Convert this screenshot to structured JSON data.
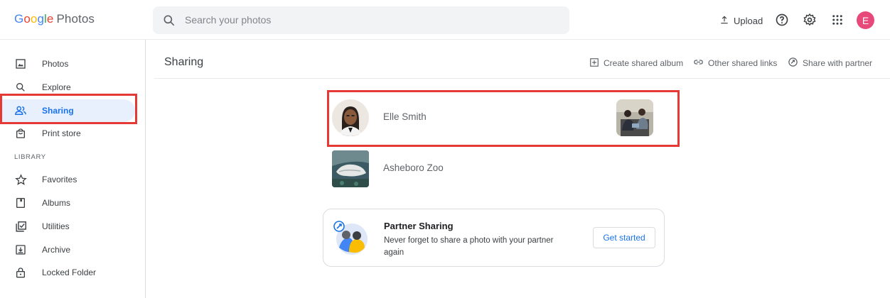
{
  "app": {
    "logo_word": [
      "G",
      "o",
      "o",
      "g",
      "l",
      "e"
    ],
    "product": "Photos"
  },
  "search": {
    "placeholder": "Search your photos",
    "icon": "search-icon"
  },
  "header": {
    "upload_label": "Upload",
    "avatar_letter": "E",
    "avatar_color": "#e8497b"
  },
  "sidebar": {
    "items": [
      {
        "label": "Photos",
        "icon": "image-icon"
      },
      {
        "label": "Explore",
        "icon": "search-icon"
      },
      {
        "label": "Sharing",
        "icon": "people-icon",
        "active": true
      },
      {
        "label": "Print store",
        "icon": "shopping-bag-icon"
      }
    ],
    "library_heading": "LIBRARY",
    "library_items": [
      {
        "label": "Favorites",
        "icon": "star-icon"
      },
      {
        "label": "Albums",
        "icon": "album-icon"
      },
      {
        "label": "Utilities",
        "icon": "utilities-icon"
      },
      {
        "label": "Archive",
        "icon": "archive-icon"
      },
      {
        "label": "Locked Folder",
        "icon": "lock-icon"
      }
    ]
  },
  "main": {
    "title": "Sharing",
    "actions": [
      {
        "label": "Create shared album",
        "icon": "add-box-icon"
      },
      {
        "label": "Other shared links",
        "icon": "link-icon"
      },
      {
        "label": "Share with partner",
        "icon": "partner-icon"
      }
    ],
    "shares": [
      {
        "name": "Elle Smith"
      },
      {
        "name": "Asheboro Zoo"
      }
    ],
    "partner": {
      "title": "Partner Sharing",
      "description": "Never forget to share a photo with your partner again",
      "button": "Get started"
    }
  },
  "colors": {
    "accent": "#1a73e8",
    "highlight": "#e53935",
    "active_bg": "#e8f0fe"
  }
}
